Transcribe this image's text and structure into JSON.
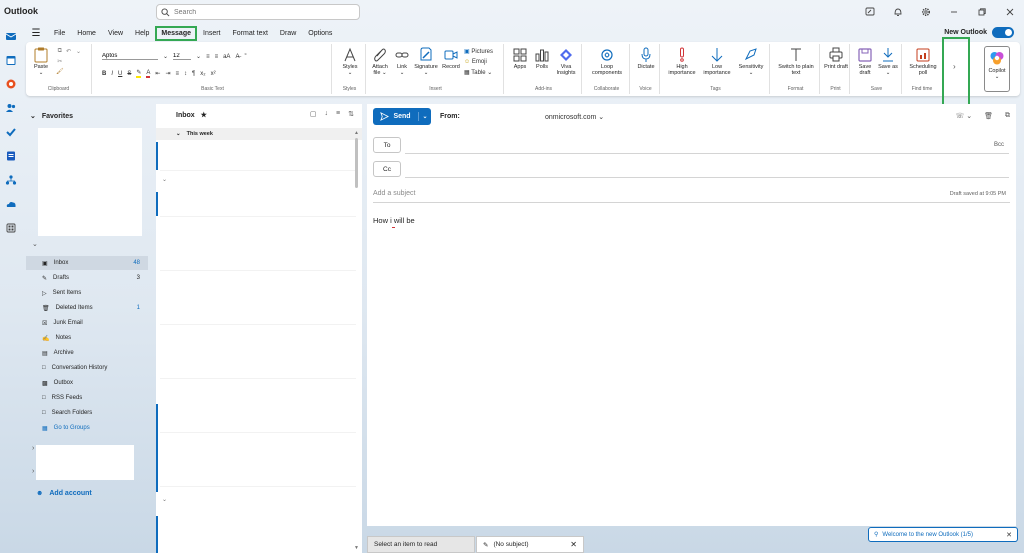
{
  "app": {
    "title": "Outlook"
  },
  "search": {
    "placeholder": "Search"
  },
  "menu": {
    "tabs": [
      "File",
      "Home",
      "View",
      "Help",
      "Message",
      "Insert",
      "Format text",
      "Draw",
      "Options"
    ],
    "active": "Message",
    "new_outlook_label": "New Outlook"
  },
  "ribbon": {
    "clipboard": {
      "paste": "Paste",
      "label": "Clipboard"
    },
    "basic_text": {
      "font": "Aptos",
      "size": "12",
      "label": "Basic Text"
    },
    "styles": {
      "button": "Styles",
      "label": "Styles"
    },
    "insert": {
      "attach": "Attach file",
      "link": "Link",
      "signature": "Signature",
      "record": "Record",
      "pictures": "Pictures",
      "emoji": "Emoji",
      "table": "Table",
      "label": "Insert"
    },
    "addins": {
      "apps": "Apps",
      "polls": "Polls",
      "viva": "Viva Insights",
      "label": "Add-ins"
    },
    "collaborate": {
      "loop": "Loop components",
      "label": "Collaborate"
    },
    "voice": {
      "dictate": "Dictate",
      "label": "Voice"
    },
    "tags": {
      "high": "High importance",
      "low": "Low importance",
      "sensitivity": "Sensitivity",
      "label": "Tags"
    },
    "format": {
      "plain": "Switch to plain text",
      "label": "Format"
    },
    "print": {
      "print_draft": "Print draft",
      "label": "Print"
    },
    "save": {
      "save_draft": "Save draft",
      "save_as": "Save as",
      "label": "Save"
    },
    "find_time": {
      "scheduling_poll": "Scheduling poll",
      "label": "Find time"
    },
    "copilot": "Copilot"
  },
  "folders": {
    "favorites_label": "Favorites",
    "items": [
      {
        "name": "Inbox",
        "count": "48",
        "icon": "inbox-icon"
      },
      {
        "name": "Drafts",
        "count": "3",
        "icon": "drafts-icon"
      },
      {
        "name": "Sent Items",
        "count": "",
        "icon": "sent-icon"
      },
      {
        "name": "Deleted Items",
        "count": "1",
        "icon": "trash-icon"
      },
      {
        "name": "Junk Email",
        "count": "",
        "icon": "junk-icon"
      },
      {
        "name": "Notes",
        "count": "",
        "icon": "notes-icon"
      },
      {
        "name": "Archive",
        "count": "",
        "icon": "archive-icon"
      },
      {
        "name": "Conversation History",
        "count": "",
        "icon": "folder-icon"
      },
      {
        "name": "Outbox",
        "count": "",
        "icon": "outbox-icon"
      },
      {
        "name": "RSS Feeds",
        "count": "",
        "icon": "folder-icon"
      },
      {
        "name": "Search Folders",
        "count": "",
        "icon": "search-folder-icon"
      },
      {
        "name": "Go to Groups",
        "count": "",
        "icon": "groups-icon"
      }
    ],
    "add_account": "Add account"
  },
  "message_list": {
    "title": "Inbox",
    "group_label": "This week"
  },
  "compose": {
    "send_label": "Send",
    "from_label": "From:",
    "from_value": "onmicrosoft.com",
    "to_label": "To",
    "cc_label": "Cc",
    "bcc_label": "Bcc",
    "subject_placeholder": "Add a subject",
    "draft_saved": "Draft saved at 9:05 PM",
    "body": "How i will be"
  },
  "bottom": {
    "reading_tab": "Select an item to read",
    "draft_tab": "(No subject)",
    "welcome": "Welcome to the new Outlook (1/5)"
  },
  "colors": {
    "accent": "#0f6cbd",
    "highlight": "#34a853",
    "danger": "#d13438"
  }
}
